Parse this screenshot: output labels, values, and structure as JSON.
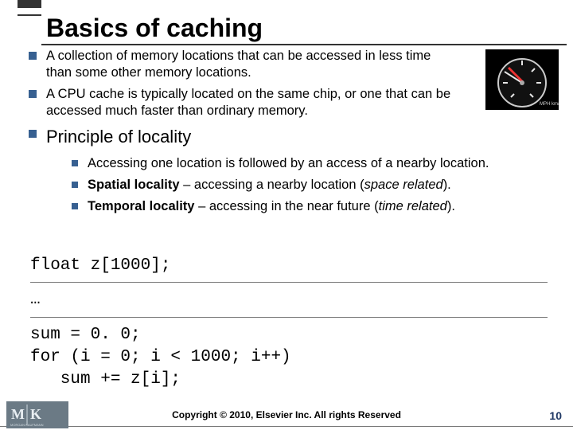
{
  "title": "Basics of caching",
  "bullets": [
    "A collection of memory locations that can be accessed in less time than some other memory locations.",
    "A CPU cache is typically located on the same chip, or one that can be accessed much faster than ordinary memory."
  ],
  "subhead": "Principle of locality",
  "sub_bullets": {
    "b0": "Accessing one location is followed by an access of a nearby location.",
    "b1_bold": "Spatial locality",
    "b1_rest_a": " – accessing a nearby location (",
    "b1_em": "space related",
    "b1_rest_b": ").",
    "b2_bold": "Temporal locality",
    "b2_rest_a": " – accessing in the near future (",
    "b2_em": "time related",
    "b2_rest_b": ")."
  },
  "code": {
    "l1": "float z[1000];",
    "l2": "…",
    "l3": "sum = 0. 0;",
    "l4": "for (i = 0; i < 1000; i++)",
    "l5": "   sum += z[i];"
  },
  "image": {
    "alt": "speedometer-gauge"
  },
  "footer": {
    "copyright": "Copyright © 2010, Elsevier Inc. All rights Reserved",
    "page": "10",
    "logo": "MK"
  }
}
